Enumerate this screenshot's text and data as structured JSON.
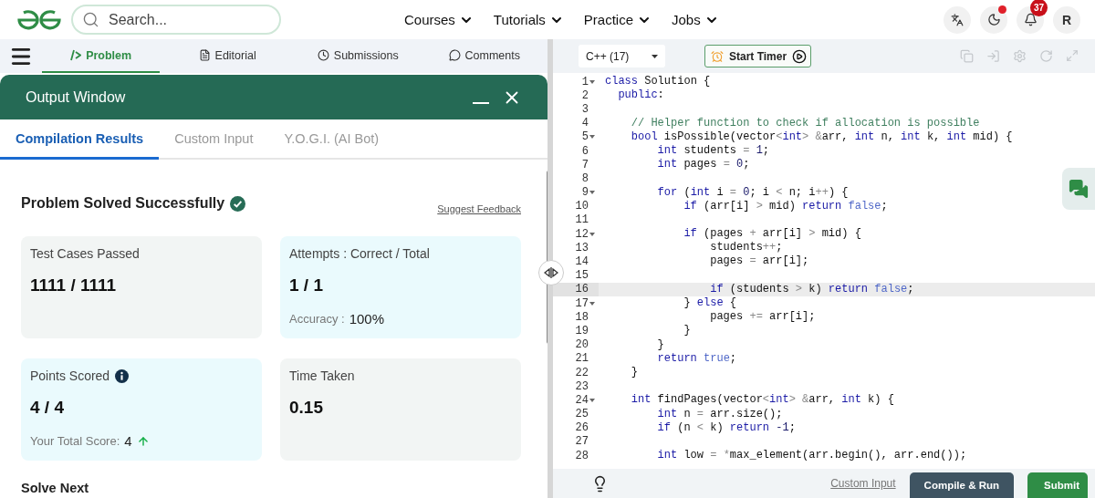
{
  "top_bar": {
    "search": {
      "placeholder": "Search..."
    },
    "menu": [
      {
        "label": "Courses"
      },
      {
        "label": "Tutorials"
      },
      {
        "label": "Practice"
      },
      {
        "label": "Jobs"
      }
    ],
    "theme_button": {
      "alert": true
    },
    "notifications": {
      "badge": "37"
    },
    "avatar": {
      "initial": "R"
    }
  },
  "problem_tabs": [
    {
      "label": "Problem",
      "selected": true
    },
    {
      "label": "Editorial",
      "selected": false
    },
    {
      "label": "Submissions",
      "selected": false
    },
    {
      "label": "Comments",
      "selected": false
    }
  ],
  "output_window": {
    "title": "Output Window",
    "tabs": [
      {
        "label": "Compilation Results",
        "selected": true
      },
      {
        "label": "Custom Input",
        "selected": false
      },
      {
        "label": "Y.O.G.I. (AI Bot)",
        "selected": false
      }
    ],
    "status": "Problem Solved Successfully",
    "feedback_link": "Suggest Feedback",
    "cards": [
      {
        "label": "Test Cases Passed",
        "value": "1111 / 1111",
        "color": "#f2f5f4",
        "info": false
      },
      {
        "label": "Attempts : Correct / Total",
        "value": "1 / 1",
        "color": "#eafafd",
        "info": false,
        "note": {
          "label": "Accuracy :",
          "value": "100%",
          "rising": false
        }
      },
      {
        "label": "Points Scored",
        "value": "4 / 4",
        "color": "#eafafd",
        "info": true,
        "note": {
          "label": "Your Total Score:",
          "value": "4",
          "rising": true
        }
      },
      {
        "label": "Time Taken",
        "value": "0.15",
        "color": "#f2f5f4",
        "info": false
      }
    ],
    "solve_next": "Solve Next"
  },
  "editor": {
    "language": "C++ (17)",
    "timer_button": "Start Timer",
    "lines": [
      {
        "number": "1",
        "foldable": true,
        "active": false,
        "tokens": [
          {
            "kind": "keyword",
            "text": "class"
          },
          {
            "kind": "plain",
            "text": " Solution {"
          }
        ]
      },
      {
        "number": "2",
        "foldable": false,
        "active": false,
        "tokens": [
          {
            "kind": "keyword",
            "text": "  public"
          },
          {
            "kind": "plain",
            "text": ":"
          }
        ]
      },
      {
        "number": "3",
        "foldable": false,
        "active": false
      },
      {
        "number": "4",
        "foldable": false,
        "active": false,
        "tokens": [
          {
            "kind": "comment",
            "text": "    // Helper function to check if allocation is possible"
          }
        ]
      },
      {
        "number": "5",
        "foldable": true,
        "active": false,
        "tokens": [
          {
            "kind": "keyword",
            "text": "    bool"
          },
          {
            "kind": "plain",
            "text": " isPossible(vector"
          },
          {
            "kind": "operator",
            "text": "<"
          },
          {
            "kind": "keyword",
            "text": "int"
          },
          {
            "kind": "operator",
            "text": "> &"
          },
          {
            "kind": "plain",
            "text": "arr, "
          },
          {
            "kind": "keyword",
            "text": "int"
          },
          {
            "kind": "plain",
            "text": " n, "
          },
          {
            "kind": "keyword",
            "text": "int"
          },
          {
            "kind": "plain",
            "text": " k, "
          },
          {
            "kind": "keyword",
            "text": "int"
          },
          {
            "kind": "plain",
            "text": " mid) {"
          }
        ]
      },
      {
        "number": "6",
        "foldable": false,
        "active": false,
        "tokens": [
          {
            "kind": "keyword",
            "text": "        int"
          },
          {
            "kind": "plain",
            "text": " students "
          },
          {
            "kind": "operator",
            "text": "= "
          },
          {
            "kind": "number",
            "text": "1"
          },
          {
            "kind": "plain",
            "text": ";"
          }
        ]
      },
      {
        "number": "7",
        "foldable": false,
        "active": false,
        "tokens": [
          {
            "kind": "keyword",
            "text": "        int"
          },
          {
            "kind": "plain",
            "text": " pages "
          },
          {
            "kind": "operator",
            "text": "= "
          },
          {
            "kind": "number",
            "text": "0"
          },
          {
            "kind": "plain",
            "text": ";"
          }
        ]
      },
      {
        "number": "8",
        "foldable": false,
        "active": false
      },
      {
        "number": "9",
        "foldable": true,
        "active": false,
        "tokens": [
          {
            "kind": "keyword",
            "text": "        for"
          },
          {
            "kind": "plain",
            "text": " ("
          },
          {
            "kind": "keyword",
            "text": "int"
          },
          {
            "kind": "plain",
            "text": " i "
          },
          {
            "kind": "operator",
            "text": "= "
          },
          {
            "kind": "number",
            "text": "0"
          },
          {
            "kind": "plain",
            "text": "; i "
          },
          {
            "kind": "operator",
            "text": "<"
          },
          {
            "kind": "plain",
            "text": " n; i"
          },
          {
            "kind": "operator",
            "text": "++"
          },
          {
            "kind": "plain",
            "text": ") {"
          }
        ]
      },
      {
        "number": "10",
        "foldable": false,
        "active": false,
        "tokens": [
          {
            "kind": "keyword",
            "text": "            if"
          },
          {
            "kind": "plain",
            "text": " (arr[i] "
          },
          {
            "kind": "operator",
            "text": ">"
          },
          {
            "kind": "plain",
            "text": " mid) "
          },
          {
            "kind": "keyword",
            "text": "return"
          },
          {
            "kind": "constant",
            "text": " false"
          },
          {
            "kind": "plain",
            "text": ";"
          }
        ]
      },
      {
        "number": "11",
        "foldable": false,
        "active": false
      },
      {
        "number": "12",
        "foldable": true,
        "active": false,
        "tokens": [
          {
            "kind": "keyword",
            "text": "            if"
          },
          {
            "kind": "plain",
            "text": " (pages "
          },
          {
            "kind": "operator",
            "text": "+"
          },
          {
            "kind": "plain",
            "text": " arr[i] "
          },
          {
            "kind": "operator",
            "text": ">"
          },
          {
            "kind": "plain",
            "text": " mid) {"
          }
        ]
      },
      {
        "number": "13",
        "foldable": false,
        "active": false,
        "tokens": [
          {
            "kind": "plain",
            "text": "                students"
          },
          {
            "kind": "operator",
            "text": "++"
          },
          {
            "kind": "plain",
            "text": ";"
          }
        ]
      },
      {
        "number": "14",
        "foldable": false,
        "active": false,
        "tokens": [
          {
            "kind": "plain",
            "text": "                pages "
          },
          {
            "kind": "operator",
            "text": "="
          },
          {
            "kind": "plain",
            "text": " arr[i];"
          }
        ]
      },
      {
        "number": "15",
        "foldable": false,
        "active": false
      },
      {
        "number": "16",
        "foldable": false,
        "active": true,
        "tokens": [
          {
            "kind": "keyword",
            "text": "                if"
          },
          {
            "kind": "plain",
            "text": " (students "
          },
          {
            "kind": "operator",
            "text": ">"
          },
          {
            "kind": "plain",
            "text": " k) "
          },
          {
            "kind": "keyword",
            "text": "return"
          },
          {
            "kind": "constant",
            "text": " false"
          },
          {
            "kind": "plain",
            "text": ";"
          }
        ]
      },
      {
        "number": "17",
        "foldable": true,
        "active": false,
        "tokens": [
          {
            "kind": "plain",
            "text": "            } "
          },
          {
            "kind": "keyword",
            "text": "else"
          },
          {
            "kind": "plain",
            "text": " {"
          }
        ]
      },
      {
        "number": "18",
        "foldable": false,
        "active": false,
        "tokens": [
          {
            "kind": "plain",
            "text": "                pages "
          },
          {
            "kind": "operator",
            "text": "+="
          },
          {
            "kind": "plain",
            "text": " arr[i];"
          }
        ]
      },
      {
        "number": "19",
        "foldable": false,
        "active": false,
        "tokens": [
          {
            "kind": "plain",
            "text": "            }"
          }
        ]
      },
      {
        "number": "20",
        "foldable": false,
        "active": false,
        "tokens": [
          {
            "kind": "plain",
            "text": "        }"
          }
        ]
      },
      {
        "number": "21",
        "foldable": false,
        "active": false,
        "tokens": [
          {
            "kind": "keyword",
            "text": "        return"
          },
          {
            "kind": "constant",
            "text": " true"
          },
          {
            "kind": "plain",
            "text": ";"
          }
        ]
      },
      {
        "number": "22",
        "foldable": false,
        "active": false,
        "tokens": [
          {
            "kind": "plain",
            "text": "    }"
          }
        ]
      },
      {
        "number": "23",
        "foldable": false,
        "active": false
      },
      {
        "number": "24",
        "foldable": true,
        "active": false,
        "tokens": [
          {
            "kind": "keyword",
            "text": "    int"
          },
          {
            "kind": "plain",
            "text": " findPages(vector"
          },
          {
            "kind": "operator",
            "text": "<"
          },
          {
            "kind": "keyword",
            "text": "int"
          },
          {
            "kind": "operator",
            "text": "> &"
          },
          {
            "kind": "plain",
            "text": "arr, "
          },
          {
            "kind": "keyword",
            "text": "int"
          },
          {
            "kind": "plain",
            "text": " k) {"
          }
        ]
      },
      {
        "number": "25",
        "foldable": false,
        "active": false,
        "tokens": [
          {
            "kind": "keyword",
            "text": "        int"
          },
          {
            "kind": "plain",
            "text": " n "
          },
          {
            "kind": "operator",
            "text": "="
          },
          {
            "kind": "plain",
            "text": " arr.size();"
          }
        ]
      },
      {
        "number": "26",
        "foldable": false,
        "active": false,
        "tokens": [
          {
            "kind": "keyword",
            "text": "        if"
          },
          {
            "kind": "plain",
            "text": " (n "
          },
          {
            "kind": "operator",
            "text": "<"
          },
          {
            "kind": "plain",
            "text": " k) "
          },
          {
            "kind": "keyword",
            "text": "return"
          },
          {
            "kind": "number",
            "text": " -1"
          },
          {
            "kind": "plain",
            "text": ";"
          }
        ]
      },
      {
        "number": "27",
        "foldable": false,
        "active": false
      },
      {
        "number": "28",
        "foldable": false,
        "active": false,
        "tokens": [
          {
            "kind": "keyword",
            "text": "        int"
          },
          {
            "kind": "plain",
            "text": " low "
          },
          {
            "kind": "operator",
            "text": "= *"
          },
          {
            "kind": "plain",
            "text": "max_element(arr.begin(), arr.end());"
          }
        ]
      }
    ]
  },
  "footer": {
    "custom_input": "Custom Input",
    "compile_button": "Compile & Run",
    "submit_button": "Submit"
  }
}
